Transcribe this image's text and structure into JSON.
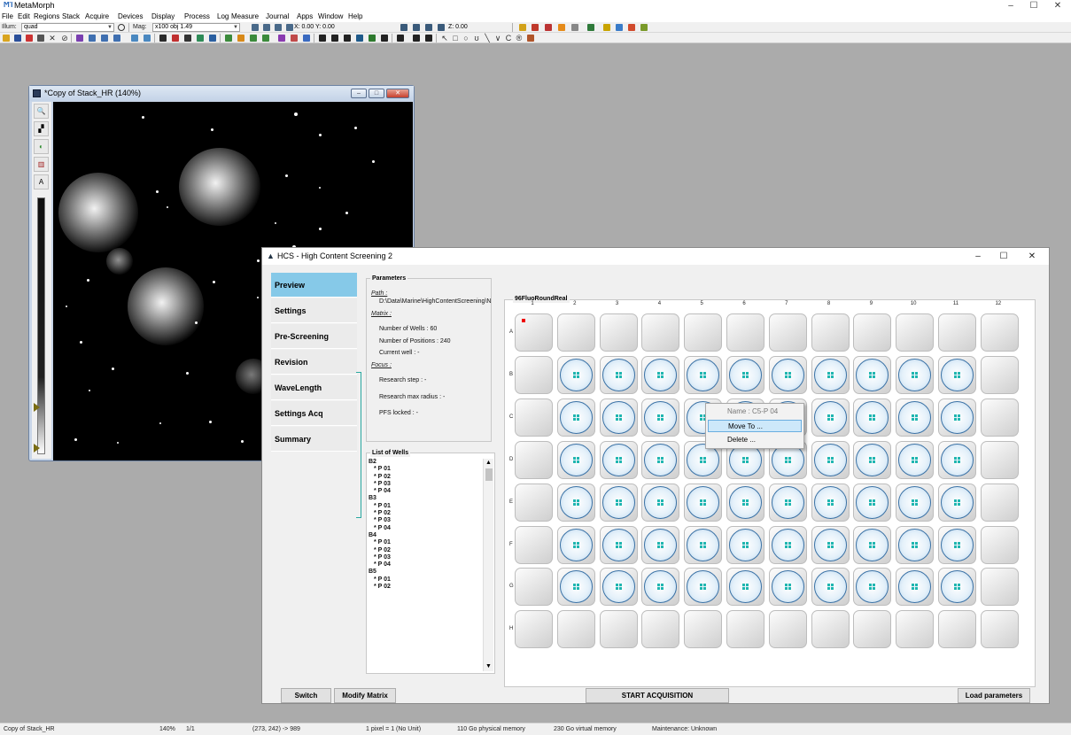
{
  "app": {
    "title": "MetaMorph",
    "logo": "ϺΊ",
    "controls": [
      "–",
      "☐",
      "✕"
    ]
  },
  "menu": [
    "File",
    "Edit",
    "Regions",
    "Stack",
    "Acquire",
    "Devices",
    "Display",
    "Process",
    "Log",
    "Measure",
    "Journal",
    "Apps",
    "Window",
    "Help"
  ],
  "toolbar": {
    "illum_label": "Illum:",
    "illum_value": "quad",
    "mag_label": "Mag:",
    "mag_value": "x100 obj 1.49",
    "xy_text": "X: 0.00  Y: 0.00",
    "z_text": "Z: 0.00"
  },
  "image_window": {
    "title": "*Copy of Stack_HR (140%)",
    "controls": [
      "–",
      "□",
      "✕"
    ],
    "tool_labels": [
      "🔍",
      "▞",
      "◐",
      "▥",
      "A"
    ]
  },
  "hcs": {
    "title": "HCS - High Content Screening 2",
    "controls": [
      "–",
      "☐",
      "✕"
    ],
    "nav_tabs": [
      "Preview",
      "Settings",
      "Pre-Screening",
      "Revision",
      "WaveLength",
      "Settings Acq",
      "Summary"
    ],
    "parameters": {
      "title": "Parameters",
      "path_label": "Path :",
      "path_value": "D:\\Data\\Marine\\HighContentScreening\\N",
      "matrix_label": "Matrix :",
      "num_wells": "Number of Wells :  60",
      "num_positions": "Number of Positions :  240",
      "current_well": "Current well :  -",
      "focus_label": "Focus :",
      "research_step": "Research step :  -",
      "research_max_radius": "Research max radius :  -",
      "pfs_locked": "PFS locked :  -"
    },
    "wells": {
      "title": "List of Wells",
      "items": [
        "B2",
        "* P 01",
        "* P 02",
        "* P 03",
        "* P 04",
        "B3",
        "* P 01",
        "* P 02",
        "* P 03",
        "* P 04",
        "B4",
        "* P 01",
        "* P 02",
        "* P 03",
        "* P 04",
        "B5",
        "* P 01",
        "* P 02"
      ]
    },
    "plate": {
      "title": "96FluoRoundReal",
      "columns": [
        "1",
        "2",
        "3",
        "4",
        "5",
        "6",
        "7",
        "8",
        "9",
        "10",
        "11",
        "12"
      ],
      "rows": [
        "A",
        "B",
        "C",
        "D",
        "E",
        "F",
        "G",
        "H"
      ]
    },
    "context_menu": {
      "name": "Name : C5-P 04",
      "move": "Move To ...",
      "delete": "Delete ..."
    },
    "buttons": {
      "switch": "Switch",
      "modify": "Modify Matrix",
      "start": "START ACQUISITION",
      "load": "Load parameters"
    }
  },
  "statusbar": {
    "file": "Copy of Stack_HR",
    "zoom": "140%",
    "plane": "1/1",
    "coord": "(273, 242) -> 989",
    "pixel": "1 pixel = 1 (No Unit)",
    "physical": "110 Go physical memory",
    "virtual": "230 Go virtual memory",
    "maintenance": "Maintenance: Unknown"
  }
}
